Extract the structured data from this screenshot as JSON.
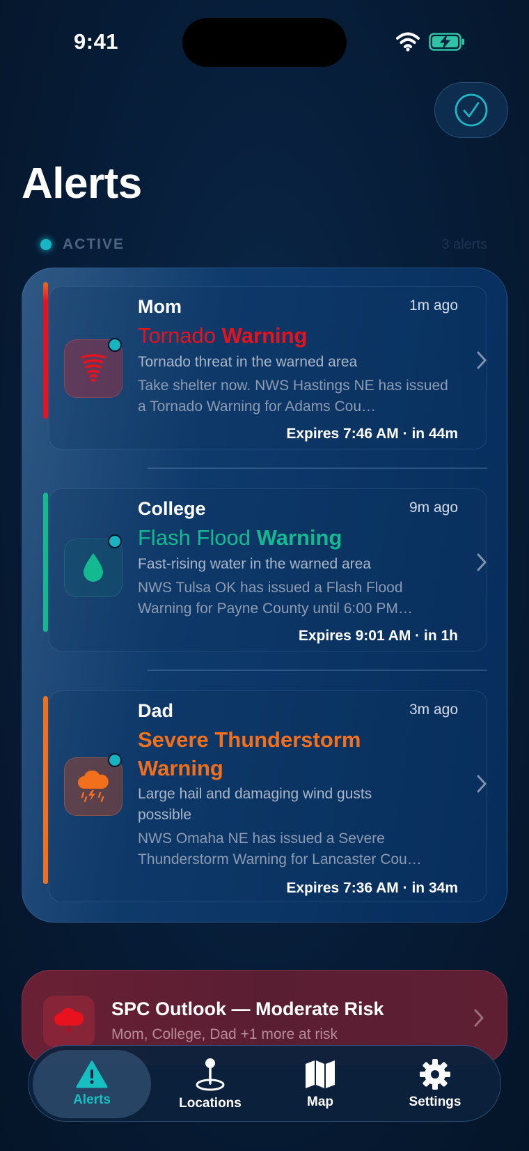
{
  "status_bar": {
    "time": "9:41"
  },
  "page": {
    "title": "Alerts"
  },
  "section": {
    "label": "ACTIVE",
    "count": "3 alerts"
  },
  "alerts": [
    {
      "who": "Mom",
      "ago": "1m ago",
      "headline_light": "Tornado",
      "headline_bold": "Warning",
      "subtitle": "Tornado threat in the warned area",
      "description": "Take shelter now. NWS Hastings NE has issued a Tornado Warning for Adams Cou…",
      "expires": "Expires 7:46 AM · in 44m",
      "icon": "tornado-icon",
      "color": "#e8121e"
    },
    {
      "who": "College",
      "ago": "9m ago",
      "headline_light": "Flash Flood",
      "headline_bold": "Warning",
      "subtitle": "Fast-rising water in the warned area",
      "description": "NWS Tulsa OK has issued a Flash Flood Warning for Payne County until 6:00 PM…",
      "expires": "Expires 9:01 AM · in 1h",
      "icon": "water-drop-icon",
      "color": "#14b990"
    },
    {
      "who": "Dad",
      "ago": "3m ago",
      "headline_light": "Severe Thunderstorm",
      "headline_bold": "Warning",
      "subtitle": "Large hail and damaging wind gusts possible",
      "description": "NWS Omaha NE has issued a Severe Thunderstorm Warning for Lancaster Cou…",
      "expires": "Expires 7:36 AM · in 34m",
      "icon": "thunderstorm-icon",
      "color": "#f2701c"
    }
  ],
  "outlook": {
    "title": "SPC Outlook — Moderate Risk",
    "subtitle": "Mom, College, Dad +1 more at risk",
    "icon": "storm-cloud-icon"
  },
  "tabs": [
    {
      "label": "Alerts",
      "icon": "warning-icon",
      "active": true
    },
    {
      "label": "Locations",
      "icon": "location-pin-icon",
      "active": false
    },
    {
      "label": "Map",
      "icon": "map-icon",
      "active": false
    },
    {
      "label": "Settings",
      "icon": "gear-icon",
      "active": false
    }
  ],
  "colors": {
    "accent": "#17b5c5",
    "background": "#061a33"
  }
}
